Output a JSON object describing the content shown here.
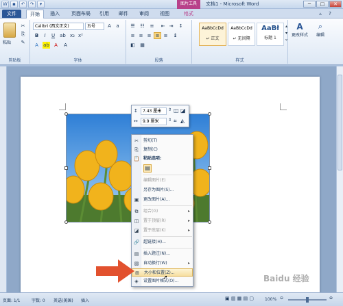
{
  "title_bar": {
    "context_tab": "图片工具",
    "doc_title": "文档1 - Microsoft Word",
    "win_buttons": {
      "minimize": "─",
      "maximize": "□",
      "close": "✕"
    }
  },
  "tabs": {
    "file": "文件",
    "items": [
      "开始",
      "插入",
      "页面布局",
      "引用",
      "邮件",
      "审阅",
      "视图",
      "格式"
    ]
  },
  "ribbon": {
    "paste_label": "粘贴",
    "font_name": "Calibri (西文正文)",
    "font_size": "五号",
    "groups": {
      "clipboard": "剪贴板",
      "font": "字体",
      "paragraph": "段落",
      "styles": "样式"
    },
    "styles": [
      {
        "preview": "AaBbCcDd",
        "name": "↵ 正文"
      },
      {
        "preview": "AaBbCcDd",
        "name": "↵ 无间隔"
      },
      {
        "preview": "AaBł",
        "name": "标题 1"
      }
    ],
    "change_styles": "更改样式",
    "editing": "编辑"
  },
  "mini_toolbar": {
    "height_value": "7.43 厘米",
    "width_value": "9.9 厘米"
  },
  "context_menu": {
    "items": [
      {
        "label": "剪切(T)",
        "icon": "scissors-icon",
        "disabled": false
      },
      {
        "label": "复制(C)",
        "icon": "copy-icon",
        "disabled": false
      },
      {
        "label": "粘贴选项:",
        "icon": "paste-icon",
        "disabled": false
      },
      {
        "label": "编辑图片(E)",
        "icon": "",
        "disabled": true
      },
      {
        "label": "另存为图片(S)...",
        "icon": "",
        "disabled": false
      },
      {
        "label": "更改图片(A)...",
        "icon": "picture-icon",
        "disabled": false
      },
      {
        "label": "组合(G)",
        "icon": "group-icon",
        "disabled": true
      },
      {
        "label": "置于顶层(R)",
        "icon": "bring-front-icon",
        "disabled": true
      },
      {
        "label": "置于底层(K)",
        "icon": "send-back-icon",
        "disabled": true
      },
      {
        "label": "超链接(H)...",
        "icon": "hyperlink-icon",
        "disabled": false
      },
      {
        "label": "插入题注(N)...",
        "icon": "caption-icon",
        "disabled": false
      },
      {
        "label": "自动换行(W)",
        "icon": "wrap-icon",
        "disabled": false
      },
      {
        "label": "大小和位置(Z)...",
        "icon": "size-position-icon",
        "disabled": false
      },
      {
        "label": "设置图片格式(O)...",
        "icon": "format-picture-icon",
        "disabled": false
      }
    ]
  },
  "status_bar": {
    "page": "页面: 1/1",
    "words": "字数: 0",
    "language": "英语(美国)",
    "mode": "插入",
    "zoom": "100%"
  },
  "watermark": "Baidu 经验"
}
